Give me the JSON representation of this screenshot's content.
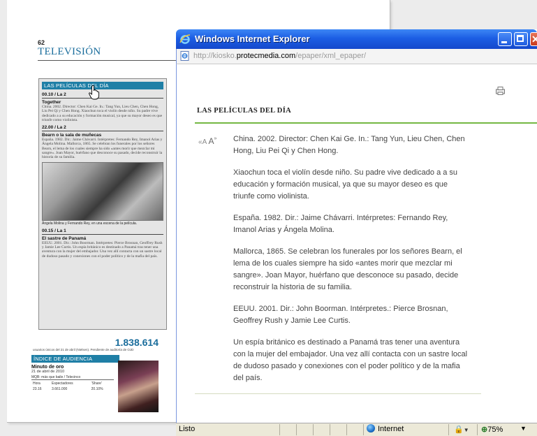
{
  "newspaper": {
    "page_number": "62",
    "section_title": "TELEVISIÓN",
    "column_heading": "LAS PELÍCULAS DEL DÍA",
    "films": [
      {
        "slot": "00.10 / La 2",
        "title": "Together",
        "text": "China. 2002. Director: Chen Kai Ge. In.: Tang Yun, Lieu Chen, Chen Hong, Liu Pei Qi y Chen Hong. Xiaochun toca el violín desde niño. Su padre vive dedicado a a su educación y formación musical, ya que su mayor deseo es que triunfe como violinista."
      },
      {
        "slot": "22.00 / La 2",
        "title": "Bearn o la sala de muñecas",
        "text": "España. 1982. Dir.: Jaime Chávarri. Intérpretes: Fernando Rey, Imanol Arias y Ángela Molina. Mallorca, 1865. Se celebran los funerales por los señores Bearn, el lema de los cuales siempre ha sido «antes morir que mezclar mi sangre». Joan Mayor, huérfano que desconoce su pasado, decide reconstruir la historia de su familia."
      },
      {
        "slot": "00.15 / La 1",
        "title": "El sastre de Panamá",
        "text": "EEUU. 2001. Dir.: John Boorman. Intérpretes: Pierce Brosnan, Geoffrey Rush y Jamie Lee Curtis. Un espía británico es destinado a Panamá tras tener una aventura con la mujer del embajador. Una vez allí contacta con un sastre local de dudoso pasado y conexiones con el poder político y de la mafia del país."
      }
    ],
    "photo_caption": "Ángela Molina y Fernando Rey, en una escena de la película.",
    "audience_number": "1.838.614",
    "audience_note": "usuarios únicos del 21 de abril (Nielsen). Pendiente de auditoría de OJD",
    "audience_heading": "ÍNDICE DE AUDIENCIA",
    "minuto_title": "Minuto de oro",
    "minuto_date": "21 de abril de 2010",
    "minuto_program": "MQB: más que baile / Telecinco",
    "table_headers": [
      "Hora",
      "Espectadores",
      "'Share'"
    ],
    "table_row": [
      "23.16",
      "3.661.000",
      "20.10%"
    ]
  },
  "browser": {
    "title": "Windows Internet Explorer",
    "url_prefix": "http://kiosko.",
    "url_domain": "protecmedia.com",
    "url_suffix": "/epaper/xml_epaper/",
    "heading": "LAS PELÍCULAS DEL DÍA",
    "font_tool_small": "A",
    "font_tool_large": "A",
    "paragraphs": [
      "China. 2002. Director: Chen Kai Ge. In.: Tang Yun, Lieu Chen, Chen Hong, Liu Pei Qi y Chen Hong.",
      "Xiaochun toca el violín desde niño. Su padre vive dedicado a a su educación y formación musical, ya que su mayor deseo es que triunfe como violinista.",
      "España. 1982. Dir.: Jaime Chávarri. Intérpretes: Fernando Rey, Imanol Arias y Ángela Molina.",
      "Mallorca, 1865. Se celebran los funerales por los señores Bearn, el lema de los cuales siempre ha sido «antes morir que mezclar mi sangre». Joan Mayor, huérfano que desconoce su pasado, decide reconstruir la historia de su familia.",
      "EEUU. 2001. Dir.: John Boorman. Intérpretes.: Pierce Brosnan, Geoffrey Rush y Jamie Lee Curtis.",
      "Un espía británico es destinado a Panamá tras tener una aventura con la mujer del embajador. Una vez allí contacta con un sastre local de dudoso pasado y conexiones con el poder político y de la mafia del país."
    ],
    "status": {
      "text": "Listo",
      "zone": "Internet",
      "zoom": "75%"
    },
    "colors": {
      "titlebar": "#1c5ee4",
      "accent_rule": "#74b843",
      "section_blue": "#1f7fa6"
    }
  }
}
